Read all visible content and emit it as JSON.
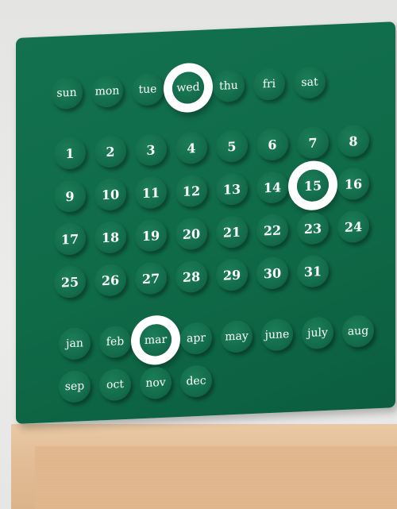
{
  "object": "perpetual calendar on wooden stand",
  "colors": {
    "board": "#12704e",
    "peg": "#136c4b",
    "ring": "#ffffff",
    "wood": "#e2bc95"
  },
  "days_of_week": [
    "sun",
    "mon",
    "tue",
    "wed",
    "thu",
    "fri",
    "sat"
  ],
  "dates": [
    "1",
    "2",
    "3",
    "4",
    "5",
    "6",
    "7",
    "8",
    "9",
    "10",
    "11",
    "12",
    "13",
    "14",
    "15",
    "16",
    "17",
    "18",
    "19",
    "20",
    "21",
    "22",
    "23",
    "24",
    "25",
    "26",
    "27",
    "28",
    "29",
    "30",
    "31"
  ],
  "months": [
    "jan",
    "feb",
    "mar",
    "apr",
    "may",
    "june",
    "july",
    "aug",
    "sep",
    "oct",
    "nov",
    "dec"
  ],
  "selected": {
    "day_of_week": "wed",
    "date": "15",
    "month": "mar"
  }
}
